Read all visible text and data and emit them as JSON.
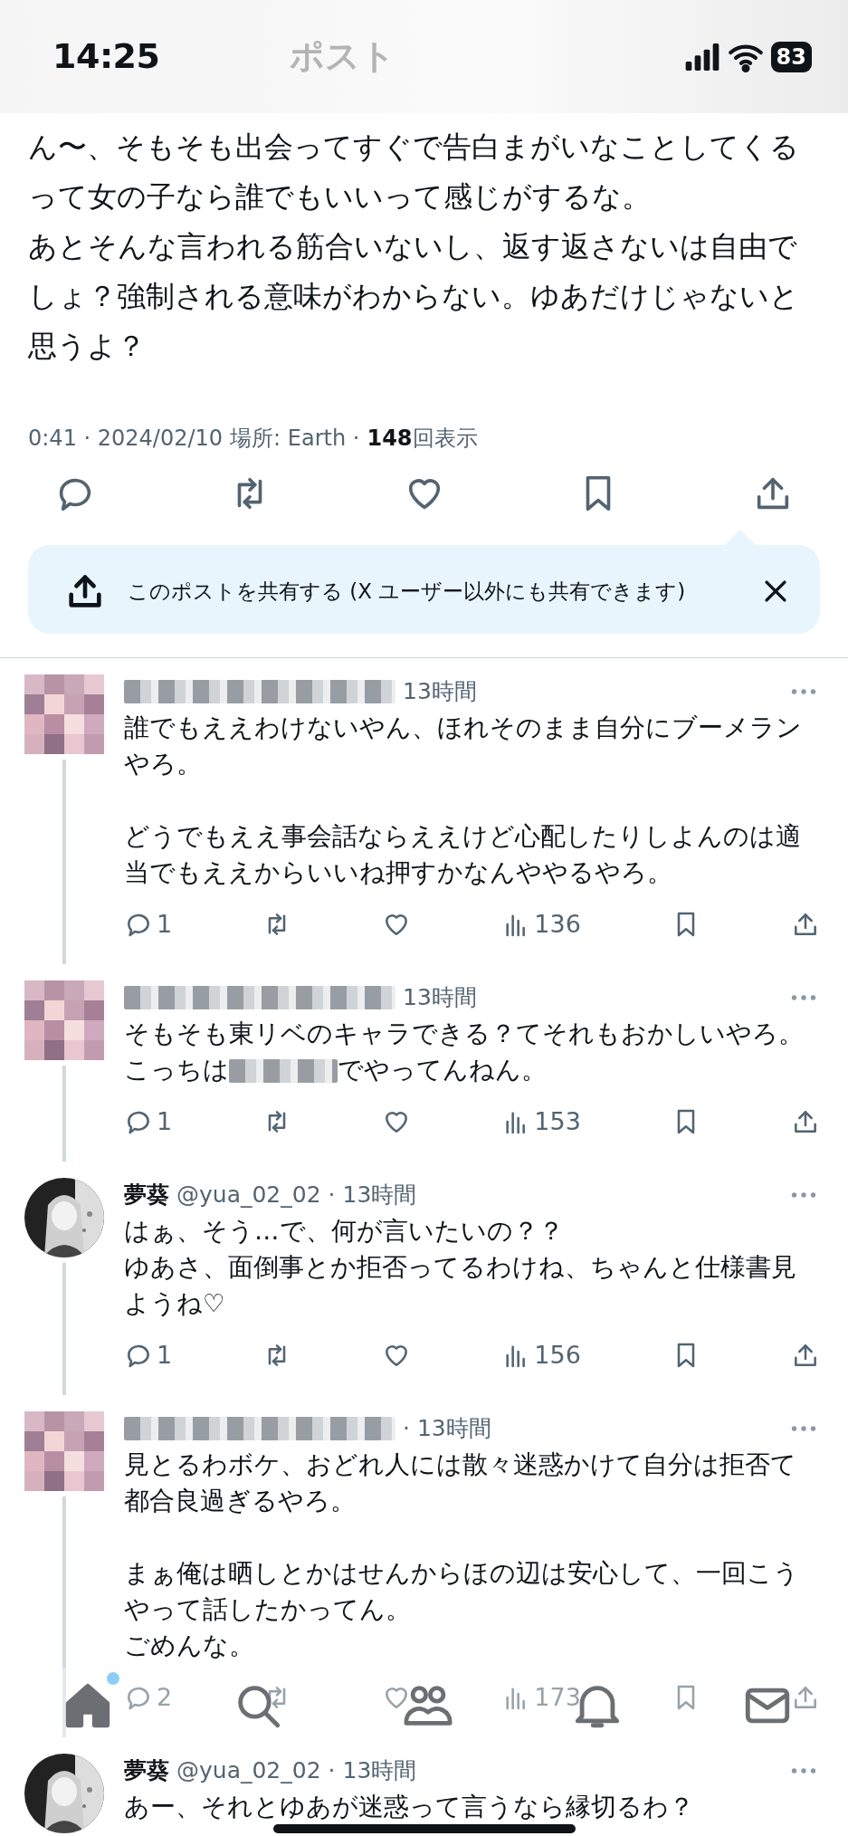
{
  "status_bar": {
    "time": "14:25",
    "battery": "83"
  },
  "header": {
    "title": "ポスト"
  },
  "post": {
    "paragraphs": [
      "ん〜、そもそも出会ってすぐで告白まがいなことしてくるって女の子なら誰でもいいって感じがするな。",
      "あとそんな言われる筋合いないし、返す返さないは自由でしょ？強制される意味がわからない。ゆあだけじゃないと思うよ？"
    ],
    "meta": {
      "time": "0:41 · 2024/02/10",
      "location": "場所: Earth ·",
      "views": "148",
      "views_label": "回表示"
    }
  },
  "share_banner": {
    "text": "このポストを共有する (X ユーザー以外にも共有できます)"
  },
  "replies": [
    {
      "author": {
        "kind": "redacted"
      },
      "avatar": {
        "kind": "pixelated"
      },
      "time": "13時間",
      "threaded": true,
      "body": [
        {
          "kind": "line",
          "parts": [
            {
              "kind": "text",
              "text": "誰でもええわけないやん、ほれそのまま自分にブーメランやろ。"
            }
          ]
        },
        {
          "kind": "paragraph",
          "parts": [
            {
              "kind": "text",
              "text": "どうでもええ事会話ならええけど心配したりしよんのは適当でもええからいいね押すかなんややるやろ。"
            }
          ]
        }
      ],
      "actions": {
        "replies": "1",
        "views": "136"
      }
    },
    {
      "author": {
        "kind": "redacted"
      },
      "avatar": {
        "kind": "pixelated"
      },
      "time": "13時間",
      "threaded": true,
      "body": [
        {
          "kind": "line",
          "parts": [
            {
              "kind": "text",
              "text": "そもそも東リベのキャラできる？てそれもおかしいやろ。"
            }
          ]
        },
        {
          "kind": "line",
          "parts": [
            {
              "kind": "text",
              "text": "こっちは"
            },
            {
              "kind": "redacted"
            },
            {
              "kind": "text",
              "text": "でやってんねん。"
            }
          ]
        }
      ],
      "actions": {
        "replies": "1",
        "views": "153"
      }
    },
    {
      "author": {
        "kind": "named",
        "name": "夢葵",
        "handle": "@yua_02_02"
      },
      "avatar": {
        "kind": "picture"
      },
      "time": "· 13時間",
      "threaded": true,
      "body": [
        {
          "kind": "line",
          "parts": [
            {
              "kind": "text",
              "text": "はぁ、そう…で、何が言いたいの？？"
            }
          ]
        },
        {
          "kind": "line",
          "parts": [
            {
              "kind": "text",
              "text": "ゆあさ、面倒事とか拒否ってるわけね、ちゃんと仕様書見ようね♡"
            }
          ]
        }
      ],
      "actions": {
        "replies": "1",
        "views": "156"
      }
    },
    {
      "author": {
        "kind": "redacted"
      },
      "avatar": {
        "kind": "pixelated"
      },
      "time": "· 13時間",
      "threaded": true,
      "body": [
        {
          "kind": "line",
          "parts": [
            {
              "kind": "text",
              "text": "見とるわボケ、おどれ人には散々迷惑かけて自分は拒否て都合良過ぎるやろ。"
            }
          ]
        },
        {
          "kind": "paragraph",
          "parts": [
            {
              "kind": "text",
              "text": "まぁ俺は晒しとかはせんからほの辺は安心して、一回こうやって話したかってん。"
            }
          ]
        },
        {
          "kind": "line",
          "parts": [
            {
              "kind": "text",
              "text": "ごめんな。"
            }
          ]
        }
      ],
      "actions": {
        "replies": "2",
        "views": "173"
      }
    },
    {
      "author": {
        "kind": "named",
        "name": "夢葵",
        "handle": "@yua_02_02"
      },
      "avatar": {
        "kind": "picture"
      },
      "time": "· 13時間",
      "threaded": false,
      "body": [
        {
          "kind": "line",
          "parts": [
            {
              "kind": "text",
              "text": "あー、それとゆあが迷惑って言うなら縁切るわ？"
            }
          ]
        }
      ]
    }
  ],
  "bottom_nav": [
    {
      "kind": "home",
      "selected": true,
      "dot": true
    },
    {
      "kind": "search",
      "selected": false,
      "dot": false
    },
    {
      "kind": "communities",
      "selected": false,
      "dot": false
    },
    {
      "kind": "notifications",
      "selected": false,
      "dot": false
    },
    {
      "kind": "messages",
      "selected": false,
      "dot": false
    }
  ]
}
